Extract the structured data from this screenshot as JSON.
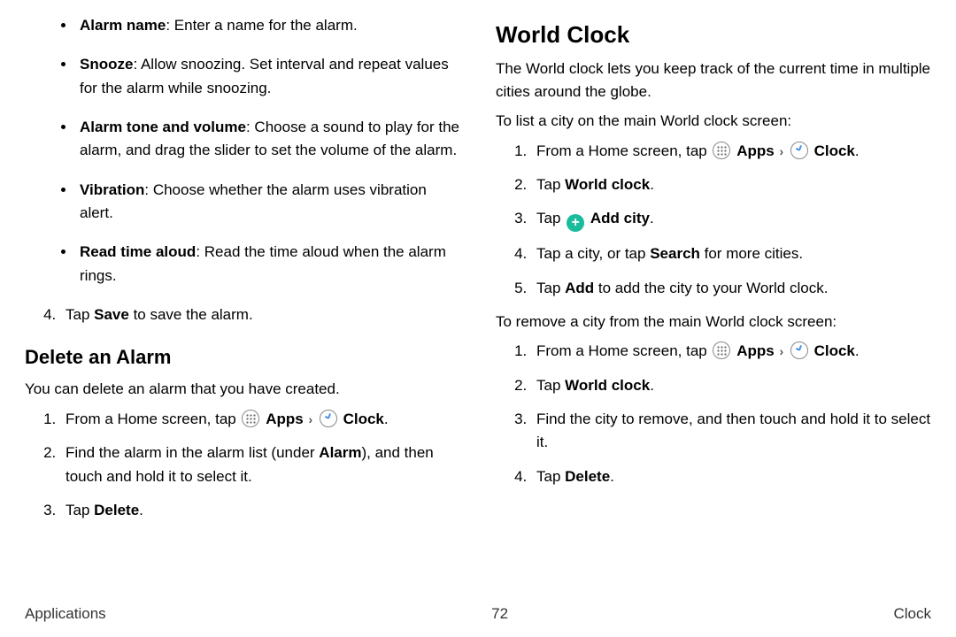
{
  "left": {
    "bullets": [
      {
        "term": "Alarm name",
        "desc": ": Enter a name for the alarm."
      },
      {
        "term": "Snooze",
        "desc": ": Allow snoozing. Set interval and repeat values for the alarm while snoozing."
      },
      {
        "term": "Alarm tone and volume",
        "desc": ": Choose a sound to play for the alarm, and drag the slider to set the volume of the alarm."
      },
      {
        "term": "Vibration",
        "desc": ": Choose whether the alarm uses vibration alert."
      },
      {
        "term": "Read time aloud",
        "desc": ": Read the time aloud when the alarm rings."
      }
    ],
    "step4_pre": "Tap ",
    "step4_bold": "Save",
    "step4_post": " to save the alarm.",
    "delete_heading": "Delete an Alarm",
    "delete_intro": "You can delete an alarm that you have created.",
    "del1_pre": "From a Home screen, tap ",
    "apps_label": "Apps",
    "clock_label": "Clock",
    "del2_a": "Find the alarm in the alarm list (under ",
    "del2_b": "Alarm",
    "del2_c": "), and then touch and hold it to select it.",
    "del3_a": "Tap ",
    "del3_b": "Delete",
    "del3_c": "."
  },
  "right": {
    "heading": "World Clock",
    "intro": "The World clock lets you keep track of the current time in multiple cities around the globe.",
    "list_intro": "To list a city on the main World clock screen:",
    "r1_pre": "From a Home screen, tap ",
    "apps_label": "Apps",
    "clock_label": "Clock",
    "r2_a": "Tap ",
    "r2_b": "World clock",
    "r2_c": ".",
    "r3_a": "Tap ",
    "r3_b": "Add city",
    "r3_c": ".",
    "r4_a": "Tap a city, or tap ",
    "r4_b": "Search",
    "r4_c": " for more cities.",
    "r5_a": "Tap ",
    "r5_b": "Add",
    "r5_c": " to add the city to your World clock.",
    "remove_intro": "To remove a city from the main World clock screen:",
    "rr1_pre": "From a Home screen, tap ",
    "rr2_a": "Tap ",
    "rr2_b": "World clock",
    "rr2_c": ".",
    "rr3": "Find the city to remove, and then touch and hold it to select it.",
    "rr4_a": "Tap ",
    "rr4_b": "Delete",
    "rr4_c": "."
  },
  "footer": {
    "left": "Applications",
    "center": "72",
    "right": "Clock"
  }
}
